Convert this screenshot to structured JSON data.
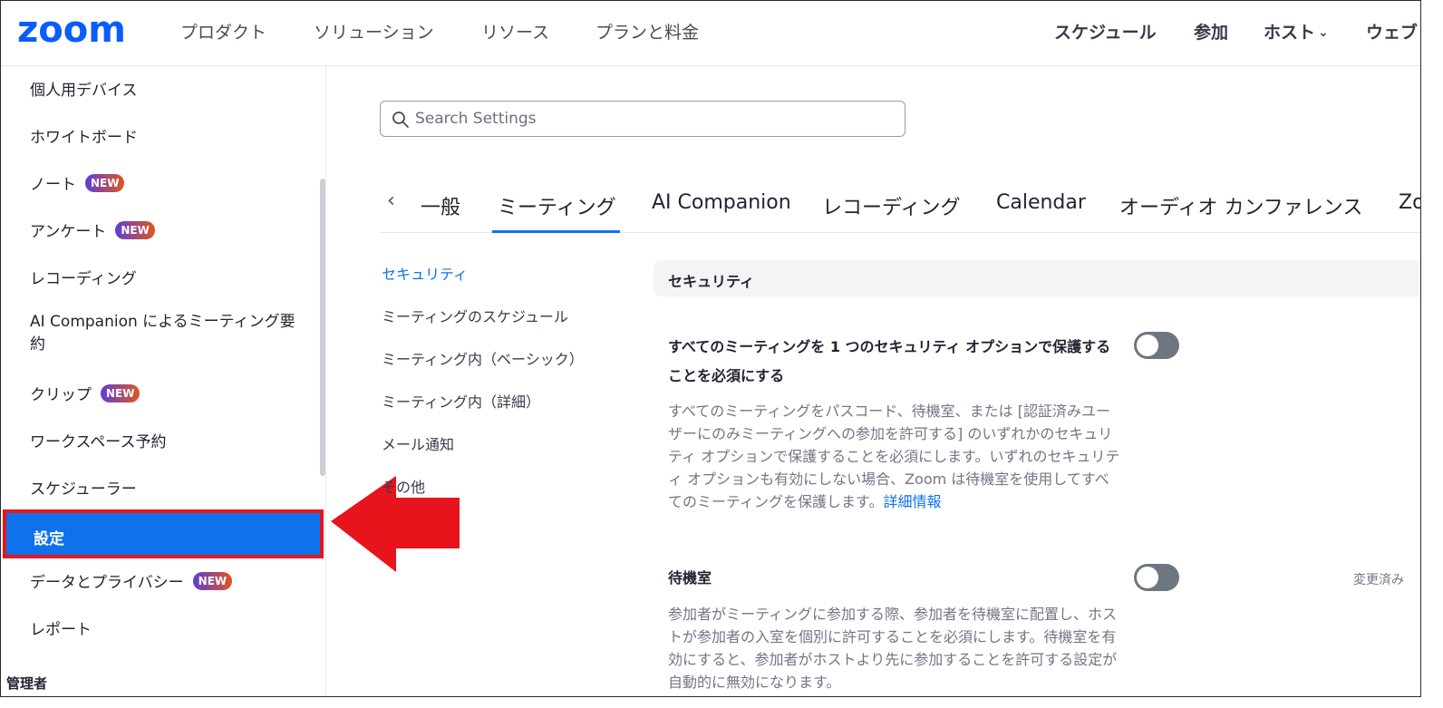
{
  "header": {
    "logo_text": "zoom",
    "nav": [
      "プロダクト",
      "ソリューション",
      "リソース",
      "プランと料金"
    ],
    "right": {
      "schedule": "スケジュール",
      "join": "参加",
      "host": "ホスト",
      "webinar": "ウェブ"
    }
  },
  "sidebar": {
    "items": [
      {
        "label": "個人用デバイス",
        "badge": ""
      },
      {
        "label": "ホワイトボード",
        "badge": ""
      },
      {
        "label": "ノート",
        "badge": "NEW"
      },
      {
        "label": "アンケート",
        "badge": "NEW"
      },
      {
        "label": "レコーディング",
        "badge": ""
      },
      {
        "label": "AI Companion によるミーティング要約",
        "badge": ""
      },
      {
        "label": "クリップ",
        "badge": "NEW"
      },
      {
        "label": "ワークスペース予約",
        "badge": ""
      },
      {
        "label": "スケジューラー",
        "badge": ""
      },
      {
        "label": "設定",
        "badge": ""
      },
      {
        "label": "データとプライバシー",
        "badge": "NEW"
      },
      {
        "label": "レポート",
        "badge": ""
      }
    ],
    "admin_label": "管理者"
  },
  "search": {
    "placeholder": "Search Settings",
    "value": ""
  },
  "tabs": {
    "items": [
      "一般",
      "ミーティング",
      "AI Companion",
      "レコーディング",
      "Calendar",
      "オーディオ カンファレンス",
      "Zo"
    ],
    "active": "ミーティング"
  },
  "subnav": {
    "items": [
      "セキュリティ",
      "ミーティングのスケジュール",
      "ミーティング内（ベーシック）",
      "ミーティング内（詳細）",
      "メール通知",
      "その他"
    ],
    "active": "セキュリティ"
  },
  "section": {
    "title": "セキュリティ",
    "settings": [
      {
        "title": "すべてのミーティングを 1 つのセキュリティ オプションで保護することを必須にする",
        "description": "すべてのミーティングをパスコード、待機室、または [認証済みユーザーにのみミーティングへの参加を許可する] のいずれかのセキュリティ オプションで保護することを必須にします。いずれのセキュリティ オプションも有効にしない場合、Zoom は待機室を使用してすべてのミーティングを保護します。",
        "link": "詳細情報",
        "enabled": false,
        "changed_label": ""
      },
      {
        "title": "待機室",
        "description": "参加者がミーティングに参加する際、参加者を待機室に配置し、ホストが参加者の入室を個別に許可することを必須にします。待機室を有効にすると、参加者がホストより先に参加することを許可する設定が自動的に無効になります。",
        "link": "",
        "enabled": false,
        "changed_label": "変更済み"
      }
    ]
  },
  "colors": {
    "accent": "#0e72ed",
    "highlight_border": "#e8141c",
    "arrow": "#e8141c",
    "toggle_off": "#6e7680"
  }
}
